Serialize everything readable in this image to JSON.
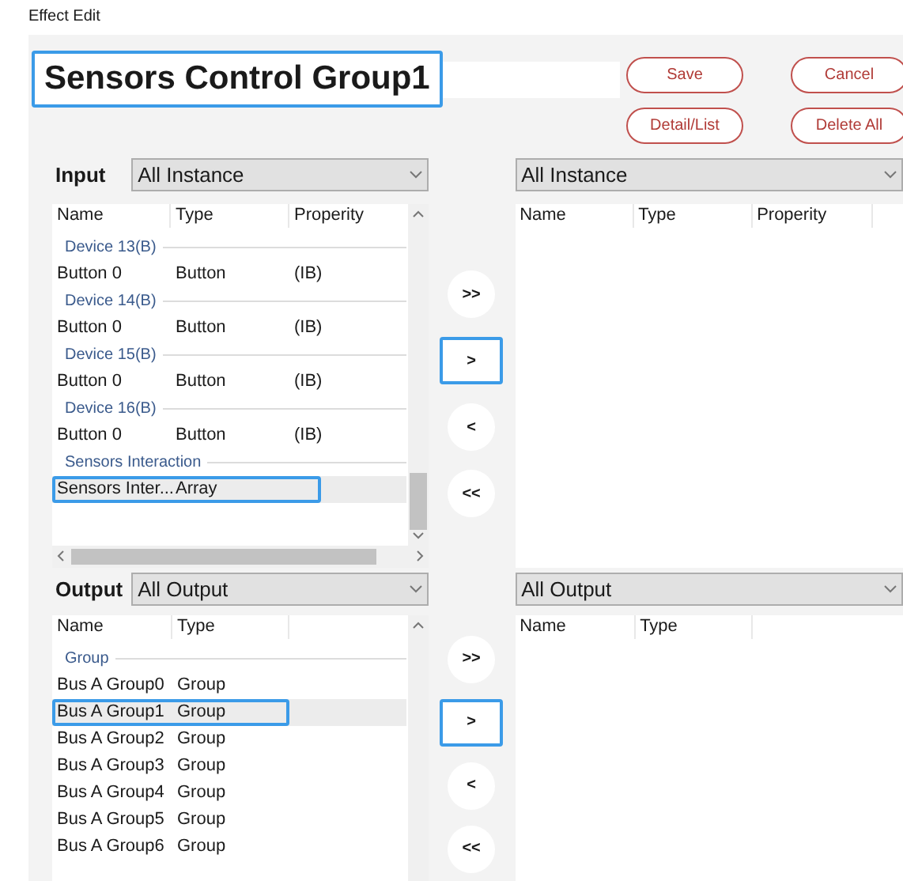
{
  "window": {
    "title": "Effect Edit"
  },
  "name_field": {
    "value": "Sensors Control Group1",
    "focused": true
  },
  "buttons": [
    "Save",
    "Cancel",
    "Detail/List",
    "Delete All"
  ],
  "input": {
    "label": "Input",
    "filter": "All Instance",
    "columns": [
      "Name",
      "Type",
      "Properity"
    ],
    "rows": [
      {
        "kind": "group",
        "label": "Device 13(B)"
      },
      {
        "kind": "item",
        "name": "Button 0",
        "type": "Button",
        "property": "(IB)",
        "selected": false
      },
      {
        "kind": "group",
        "label": "Device 14(B)"
      },
      {
        "kind": "item",
        "name": "Button 0",
        "type": "Button",
        "property": "(IB)",
        "selected": false
      },
      {
        "kind": "group",
        "label": "Device 15(B)"
      },
      {
        "kind": "item",
        "name": "Button 0",
        "type": "Button",
        "property": "(IB)",
        "selected": false
      },
      {
        "kind": "group",
        "label": "Device 16(B)"
      },
      {
        "kind": "item",
        "name": "Button 0",
        "type": "Button",
        "property": "(IB)",
        "selected": false
      },
      {
        "kind": "group",
        "label": "Sensors Interaction"
      },
      {
        "kind": "item",
        "name": "Sensors Inter...",
        "type": "Array",
        "selected": true
      }
    ],
    "target_filter": "All Instance",
    "target_columns": [
      "Name",
      "Type",
      "Properity"
    ],
    "move_buttons": [
      {
        "label": ">>",
        "focused": false
      },
      {
        "label": ">",
        "focused": true
      },
      {
        "label": "<",
        "focused": false
      },
      {
        "label": "<<",
        "focused": false
      }
    ]
  },
  "output": {
    "label": "Output",
    "filter": "All Output",
    "columns": [
      "Name",
      "Type"
    ],
    "rows": [
      {
        "kind": "group",
        "label": "Group"
      },
      {
        "kind": "item",
        "name": "Bus A Group0",
        "type": "Group",
        "selected": false
      },
      {
        "kind": "item",
        "name": "Bus A Group1",
        "type": "Group",
        "selected": true
      },
      {
        "kind": "item",
        "name": "Bus A Group2",
        "type": "Group",
        "selected": false
      },
      {
        "kind": "item",
        "name": "Bus A Group3",
        "type": "Group",
        "selected": false
      },
      {
        "kind": "item",
        "name": "Bus A Group4",
        "type": "Group",
        "selected": false
      },
      {
        "kind": "item",
        "name": "Bus A Group5",
        "type": "Group",
        "selected": false
      },
      {
        "kind": "item",
        "name": "Bus A Group6",
        "type": "Group",
        "selected": false
      }
    ],
    "target_filter": "All Output",
    "target_columns": [
      "Name",
      "Type"
    ],
    "move_buttons": [
      {
        "label": ">>",
        "focused": false
      },
      {
        "label": ">",
        "focused": true
      },
      {
        "label": "<",
        "focused": false
      },
      {
        "label": "<<",
        "focused": false
      }
    ]
  }
}
